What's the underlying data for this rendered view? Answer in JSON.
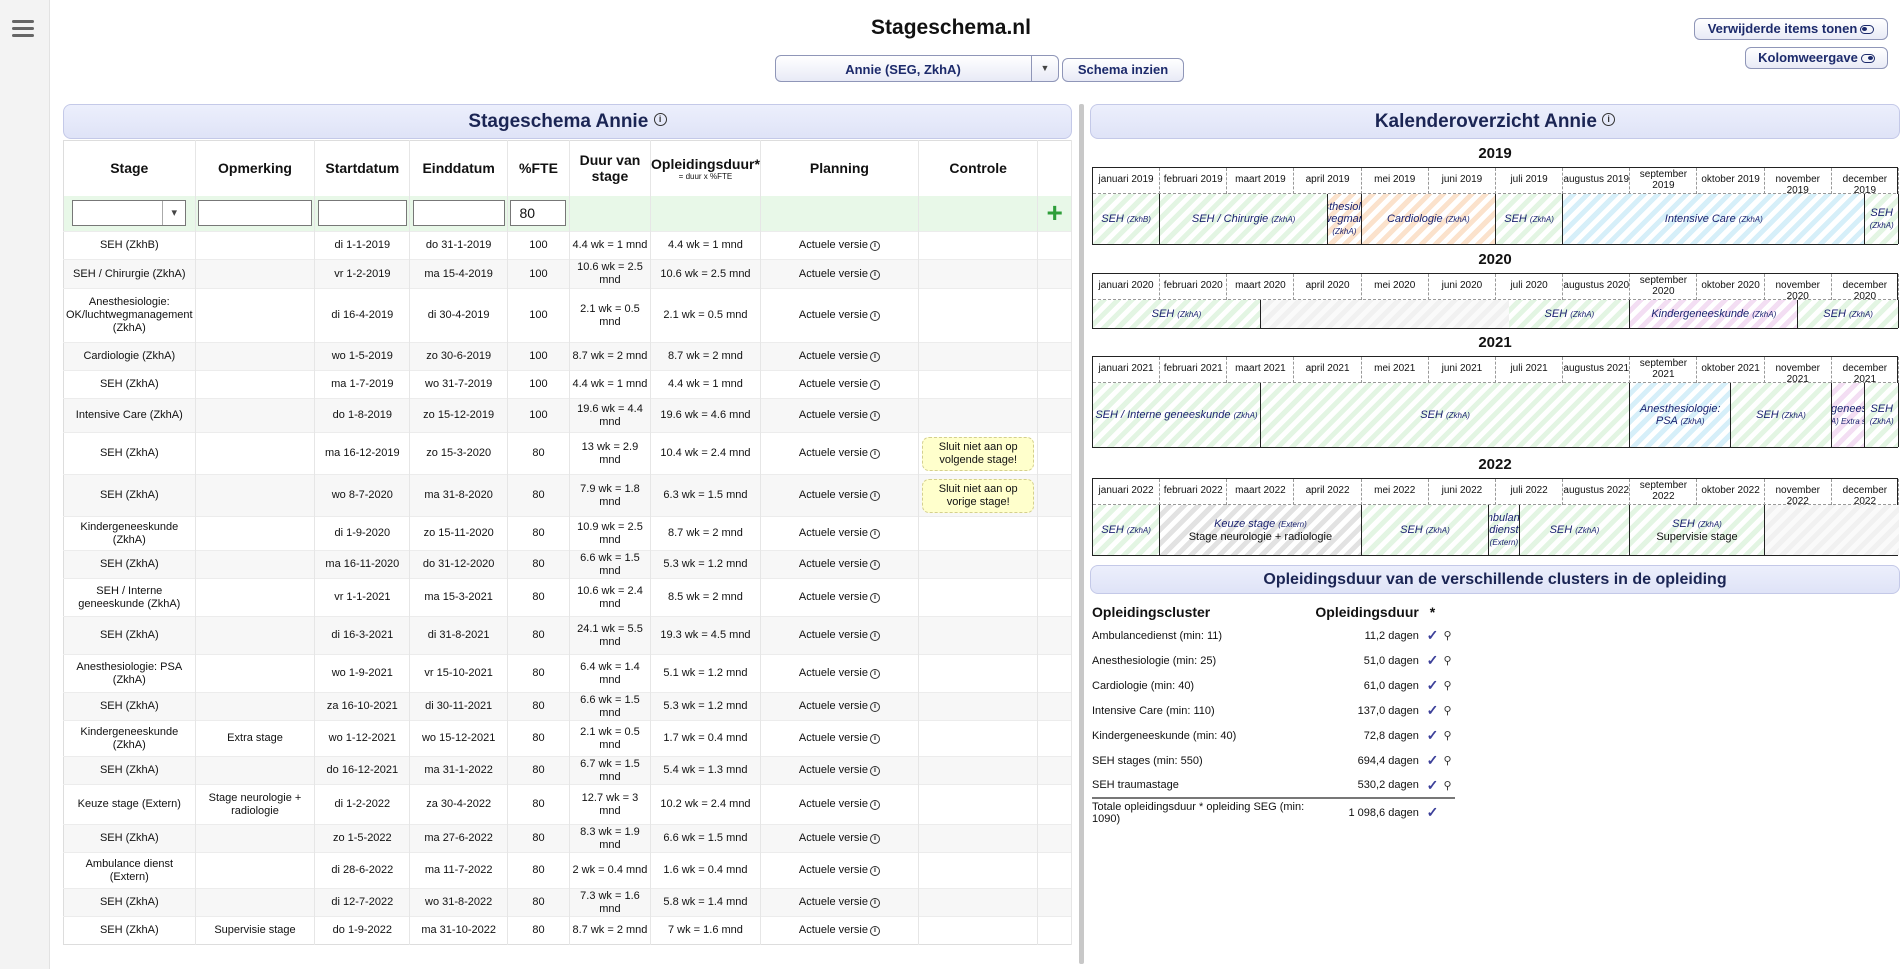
{
  "site_title": "Stageschema.nl",
  "student_select": {
    "value": "Annie (SEG, ZkhA)"
  },
  "buttons": {
    "view_schema": "Schema inzien",
    "show_removed": "Verwijderde items tonen",
    "column_view": "Kolomweergave"
  },
  "stage_section": {
    "title": "Stageschema Annie",
    "headers": {
      "stage": "Stage",
      "remark": "Opmerking",
      "start": "Startdatum",
      "end": "Einddatum",
      "fte": "%FTE",
      "duration": "Duur van stage",
      "training": "Opleidingsduur*",
      "training_note": "= duur x %FTE",
      "planning": "Planning",
      "control": "Controle"
    },
    "input_fte": "80",
    "rows": [
      {
        "stage": "SEH (ZkhB)",
        "remark": "",
        "start": "di 1-1-2019",
        "end": "do 31-1-2019",
        "fte": "100",
        "duration": "4.4 wk = 1 mnd",
        "training": "4.4 wk = 1 mnd",
        "planning": "Actuele versie",
        "control": ""
      },
      {
        "stage": "SEH / Chirurgie (ZkhA)",
        "remark": "",
        "start": "vr 1-2-2019",
        "end": "ma 15-4-2019",
        "fte": "100",
        "duration": "10.6 wk = 2.5 mnd",
        "training": "10.6 wk = 2.5 mnd",
        "planning": "Actuele versie",
        "control": ""
      },
      {
        "stage": "Anesthesiologie: OK/luchtwegmanagement (ZkhA)",
        "remark": "",
        "start": "di 16-4-2019",
        "end": "di 30-4-2019",
        "fte": "100",
        "duration": "2.1 wk = 0.5 mnd",
        "training": "2.1 wk = 0.5 mnd",
        "planning": "Actuele versie",
        "control": ""
      },
      {
        "stage": "Cardiologie (ZkhA)",
        "remark": "",
        "start": "wo 1-5-2019",
        "end": "zo 30-6-2019",
        "fte": "100",
        "duration": "8.7 wk = 2 mnd",
        "training": "8.7 wk = 2 mnd",
        "planning": "Actuele versie",
        "control": ""
      },
      {
        "stage": "SEH (ZkhA)",
        "remark": "",
        "start": "ma 1-7-2019",
        "end": "wo 31-7-2019",
        "fte": "100",
        "duration": "4.4 wk = 1 mnd",
        "training": "4.4 wk = 1 mnd",
        "planning": "Actuele versie",
        "control": ""
      },
      {
        "stage": "Intensive Care (ZkhA)",
        "remark": "",
        "start": "do 1-8-2019",
        "end": "zo 15-12-2019",
        "fte": "100",
        "duration": "19.6 wk = 4.4 mnd",
        "training": "19.6 wk = 4.6 mnd",
        "planning": "Actuele versie",
        "control": ""
      },
      {
        "stage": "SEH (ZkhA)",
        "remark": "",
        "start": "ma 16-12-2019",
        "end": "zo 15-3-2020",
        "fte": "80",
        "duration": "13 wk = 2.9 mnd",
        "training": "10.4 wk = 2.4 mnd",
        "planning": "Actuele versie",
        "control": "Sluit niet aan op volgende stage!"
      },
      {
        "stage": "SEH (ZkhA)",
        "remark": "",
        "start": "wo 8-7-2020",
        "end": "ma 31-8-2020",
        "fte": "80",
        "duration": "7.9 wk = 1.8 mnd",
        "training": "6.3 wk = 1.5 mnd",
        "planning": "Actuele versie",
        "control": "Sluit niet aan op vorige stage!"
      },
      {
        "stage": "Kindergeneeskunde (ZkhA)",
        "remark": "",
        "start": "di 1-9-2020",
        "end": "zo 15-11-2020",
        "fte": "80",
        "duration": "10.9 wk = 2.5 mnd",
        "training": "8.7 wk = 2 mnd",
        "planning": "Actuele versie",
        "control": ""
      },
      {
        "stage": "SEH (ZkhA)",
        "remark": "",
        "start": "ma 16-11-2020",
        "end": "do 31-12-2020",
        "fte": "80",
        "duration": "6.6 wk = 1.5 mnd",
        "training": "5.3 wk = 1.2 mnd",
        "planning": "Actuele versie",
        "control": ""
      },
      {
        "stage": "SEH / Interne geneeskunde (ZkhA)",
        "remark": "",
        "start": "vr 1-1-2021",
        "end": "ma 15-3-2021",
        "fte": "80",
        "duration": "10.6 wk = 2.4 mnd",
        "training": "8.5 wk = 2 mnd",
        "planning": "Actuele versie",
        "control": ""
      },
      {
        "stage": "SEH (ZkhA)",
        "remark": "",
        "start": "di 16-3-2021",
        "end": "di 31-8-2021",
        "fte": "80",
        "duration": "24.1 wk = 5.5 mnd",
        "training": "19.3 wk = 4.5 mnd",
        "planning": "Actuele versie",
        "control": ""
      },
      {
        "stage": "Anesthesiologie: PSA (ZkhA)",
        "remark": "",
        "start": "wo 1-9-2021",
        "end": "vr 15-10-2021",
        "fte": "80",
        "duration": "6.4 wk = 1.4 mnd",
        "training": "5.1 wk = 1.2 mnd",
        "planning": "Actuele versie",
        "control": ""
      },
      {
        "stage": "SEH (ZkhA)",
        "remark": "",
        "start": "za 16-10-2021",
        "end": "di 30-11-2021",
        "fte": "80",
        "duration": "6.6 wk = 1.5 mnd",
        "training": "5.3 wk = 1.2 mnd",
        "planning": "Actuele versie",
        "control": ""
      },
      {
        "stage": "Kindergeneeskunde (ZkhA)",
        "remark": "Extra stage",
        "start": "wo 1-12-2021",
        "end": "wo 15-12-2021",
        "fte": "80",
        "duration": "2.1 wk = 0.5 mnd",
        "training": "1.7 wk = 0.4 mnd",
        "planning": "Actuele versie",
        "control": ""
      },
      {
        "stage": "SEH (ZkhA)",
        "remark": "",
        "start": "do 16-12-2021",
        "end": "ma 31-1-2022",
        "fte": "80",
        "duration": "6.7 wk = 1.5 mnd",
        "training": "5.4 wk = 1.3 mnd",
        "planning": "Actuele versie",
        "control": ""
      },
      {
        "stage": "Keuze stage (Extern)",
        "remark": "Stage neurologie + radiologie",
        "start": "di 1-2-2022",
        "end": "za 30-4-2022",
        "fte": "80",
        "duration": "12.7 wk = 3 mnd",
        "training": "10.2 wk = 2.4 mnd",
        "planning": "Actuele versie",
        "control": ""
      },
      {
        "stage": "SEH (ZkhA)",
        "remark": "",
        "start": "zo 1-5-2022",
        "end": "ma 27-6-2022",
        "fte": "80",
        "duration": "8.3 wk = 1.9 mnd",
        "training": "6.6 wk = 1.5 mnd",
        "planning": "Actuele versie",
        "control": ""
      },
      {
        "stage": "Ambulance dienst (Extern)",
        "remark": "",
        "start": "di 28-6-2022",
        "end": "ma 11-7-2022",
        "fte": "80",
        "duration": "2 wk = 0.4 mnd",
        "training": "1.6 wk = 0.4 mnd",
        "planning": "Actuele versie",
        "control": ""
      },
      {
        "stage": "SEH (ZkhA)",
        "remark": "",
        "start": "di 12-7-2022",
        "end": "wo 31-8-2022",
        "fte": "80",
        "duration": "7.3 wk = 1.6 mnd",
        "training": "5.8 wk = 1.4 mnd",
        "planning": "Actuele versie",
        "control": ""
      },
      {
        "stage": "SEH (ZkhA)",
        "remark": "Supervisie stage",
        "start": "do 1-9-2022",
        "end": "ma 31-10-2022",
        "fte": "80",
        "duration": "8.7 wk = 2 mnd",
        "training": "7 wk = 1.6 mnd",
        "planning": "Actuele versie",
        "control": ""
      }
    ]
  },
  "calendar": {
    "title": "Kalenderoverzicht Annie",
    "month_names": [
      "januari",
      "februari",
      "maart",
      "april",
      "mei",
      "juni",
      "juli",
      "augustus",
      "september",
      "oktober",
      "november",
      "december"
    ],
    "years": [
      {
        "year": "2019",
        "blocks": [
          {
            "label": "SEH",
            "sub": "(ZkhB)",
            "start": 0,
            "end": 1,
            "color": "g"
          },
          {
            "label": "SEH / Chirurgie",
            "sub": "(ZkhA)",
            "start": 1,
            "end": 3.5,
            "color": "g"
          },
          {
            "label": "Anesthesiologie: OK/luchtwegmanagement",
            "sub": "(ZkhA)",
            "start": 3.5,
            "end": 4,
            "color": "o"
          },
          {
            "label": "Cardiologie",
            "sub": "(ZkhA)",
            "start": 4,
            "end": 6,
            "color": "o"
          },
          {
            "label": "SEH",
            "sub": "(ZkhA)",
            "start": 6,
            "end": 7,
            "color": "g"
          },
          {
            "label": "Intensive Care",
            "sub": "(ZkhA)",
            "start": 7,
            "end": 11.5,
            "color": "c"
          },
          {
            "label": "SEH",
            "sub": "(ZkhA)",
            "start": 11.5,
            "end": 12,
            "color": "g"
          }
        ]
      },
      {
        "year": "2020",
        "blocks": [
          {
            "label": "SEH",
            "sub": "(ZkhA)",
            "start": 0,
            "end": 2.5,
            "color": "g"
          },
          {
            "label": "",
            "sub": "",
            "start": 2.5,
            "end": 6.2,
            "color": "empty"
          },
          {
            "label": "SEH",
            "sub": "(ZkhA)",
            "start": 6.2,
            "end": 8,
            "color": "g"
          },
          {
            "label": "Kindergeneeskunde",
            "sub": "(ZkhA)",
            "start": 8,
            "end": 10.5,
            "color": "p"
          },
          {
            "label": "SEH",
            "sub": "(ZkhA)",
            "start": 10.5,
            "end": 12,
            "color": "g"
          }
        ]
      },
      {
        "year": "2021",
        "blocks": [
          {
            "label": "SEH / Interne geneeskunde",
            "sub": "(ZkhA)",
            "start": 0,
            "end": 2.5,
            "color": "g"
          },
          {
            "label": "SEH",
            "sub": "(ZkhA)",
            "start": 2.5,
            "end": 8,
            "color": "g"
          },
          {
            "label": "Anesthesiologie: PSA",
            "sub": "(ZkhA)",
            "start": 8,
            "end": 9.5,
            "color": "c"
          },
          {
            "label": "SEH",
            "sub": "(ZkhA)",
            "start": 9.5,
            "end": 11,
            "color": "g"
          },
          {
            "label": "Kindergeneeskunde",
            "sub": "(ZkhA) Extra stage",
            "start": 11,
            "end": 11.5,
            "color": "p"
          },
          {
            "label": "SEH",
            "sub": "(ZkhA)",
            "start": 11.5,
            "end": 12,
            "color": "g"
          }
        ]
      },
      {
        "year": "2022",
        "blocks": [
          {
            "label": "SEH",
            "sub": "(ZkhA)",
            "start": 0,
            "end": 1,
            "color": "g"
          },
          {
            "label": "Keuze stage",
            "sub": "(Extern)",
            "extra": "Stage neurologie + radiologie",
            "start": 1,
            "end": 4,
            "color": "gr"
          },
          {
            "label": "SEH",
            "sub": "(ZkhA)",
            "start": 4,
            "end": 5.9,
            "color": "g"
          },
          {
            "label": "Ambulance dienst",
            "sub": "(Extern)",
            "start": 5.9,
            "end": 6.35,
            "color": "g"
          },
          {
            "label": "SEH",
            "sub": "(ZkhA)",
            "start": 6.35,
            "end": 8,
            "color": "g"
          },
          {
            "label": "SEH",
            "sub": "(ZkhA)",
            "extra": "Supervisie stage",
            "start": 8,
            "end": 10,
            "color": "g"
          },
          {
            "label": "",
            "sub": "",
            "start": 10,
            "end": 12,
            "color": "empty"
          }
        ]
      }
    ]
  },
  "clusters": {
    "title": "Opleidingsduur van de verschillende clusters in de opleiding",
    "col_cluster": "Opleidingscluster",
    "col_duration": "Opleidingsduur",
    "col_star": "*",
    "rows": [
      {
        "name": "Ambulancedienst (min: 11)",
        "value": "11,2 dagen"
      },
      {
        "name": "Anesthesiologie (min: 25)",
        "value": "51,0 dagen"
      },
      {
        "name": "Cardiologie (min: 40)",
        "value": "61,0 dagen"
      },
      {
        "name": "Intensive Care (min: 110)",
        "value": "137,0 dagen"
      },
      {
        "name": "Kindergeneeskunde (min: 40)",
        "value": "72,8 dagen"
      },
      {
        "name": "SEH stages (min: 550)",
        "value": "694,4 dagen"
      },
      {
        "name": "SEH traumastage",
        "value": "530,2 dagen"
      }
    ],
    "total": {
      "name": "Totale opleidingsduur * opleiding SEG (min: 1090)",
      "value": "1 098,6 dagen"
    }
  }
}
